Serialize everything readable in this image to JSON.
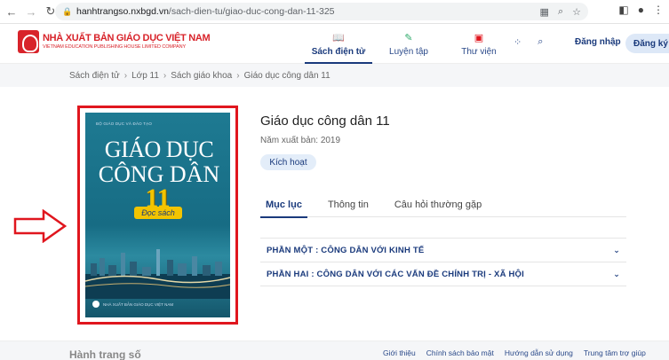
{
  "browser": {
    "host": "hanhtrangso.nxbgd.vn",
    "path": "/sach-dien-tu/giao-duc-cong-dan-11-325"
  },
  "site": {
    "logo_title": "NHÀ XUẤT BẢN GIÁO DỤC VIỆT NAM",
    "logo_sub": "VIETNAM EDUCATION PUBLISHING HOUSE LIMITED COMPANY",
    "nav": [
      {
        "label": "Sách điện tử",
        "icon": "book-icon"
      },
      {
        "label": "Luyện tập",
        "icon": "pencil-icon"
      },
      {
        "label": "Thư viện",
        "icon": "library-icon"
      }
    ],
    "login_label": "Đăng nhập",
    "register_label": "Đăng ký"
  },
  "breadcrumb": [
    "Sách điện tử",
    "Lớp 11",
    "Sách giáo khoa",
    "Giáo dục công dân 11"
  ],
  "cover": {
    "publisher_top": "BỘ GIÁO DỤC VÀ ĐÀO TẠO",
    "title_line1": "GIÁO DỤC",
    "title_line2": "CÔNG DÂN",
    "grade": "11",
    "badge": "Đọc sách",
    "publisher_bottom": "NHÀ XUẤT BẢN GIÁO DỤC VIỆT NAM"
  },
  "book": {
    "title": "Giáo dục công dân 11",
    "year": "Năm xuất bản: 2019",
    "activate_label": "Kích hoạt"
  },
  "tabs": [
    "Mục lục",
    "Thông tin",
    "Câu hỏi thường gặp"
  ],
  "toc": [
    "PHẦN MỘT :  CÔNG DÂN VỚI KINH TẾ",
    "PHẦN HAI :  CÔNG DÂN VỚI CÁC VẤN ĐỀ CHÍNH TRỊ - XÃ HỘI"
  ],
  "footer": {
    "brand": "Hành trang số",
    "links": [
      "Giới thiệu",
      "Chính sách bảo mật",
      "Hướng dẫn sử dụng",
      "Trung tâm trợ giúp"
    ]
  },
  "colors": {
    "brand_red": "#d8232a",
    "brand_blue": "#1a3a7c",
    "highlight_red": "#e0161e"
  }
}
